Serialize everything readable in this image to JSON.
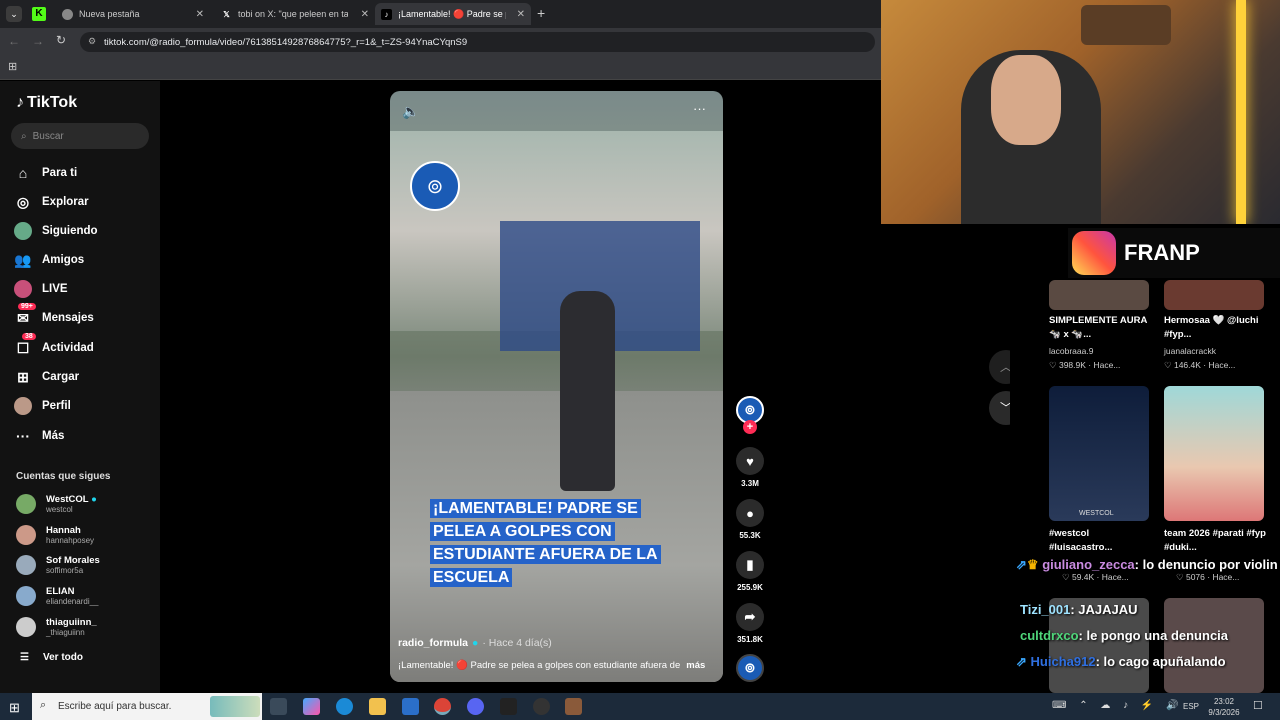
{
  "browser": {
    "tabs": [
      {
        "title": "Nueva pestaña"
      },
      {
        "title": "tobi on X: \"que peleen en tang"
      },
      {
        "title": "¡Lamentable! 🔴 Padre se pele"
      }
    ],
    "url": "tiktok.com/@radio_formula/video/7613851492876864775?_r=1&_t=ZS-94YnaCYqnS9"
  },
  "tiktok": {
    "logo": "TikTok",
    "search_placeholder": "Buscar",
    "nav": [
      {
        "label": "Para ti",
        "icon": "home-icon"
      },
      {
        "label": "Explorar",
        "icon": "compass-icon"
      },
      {
        "label": "Siguiendo",
        "icon": "following-icon"
      },
      {
        "label": "Amigos",
        "icon": "friends-icon"
      },
      {
        "label": "LIVE",
        "icon": "live-icon"
      },
      {
        "label": "Mensajes",
        "icon": "messages-icon",
        "badge": "99+"
      },
      {
        "label": "Actividad",
        "icon": "activity-icon",
        "badge": "38"
      },
      {
        "label": "Cargar",
        "icon": "upload-icon"
      },
      {
        "label": "Perfil",
        "icon": "profile-icon"
      },
      {
        "label": "Más",
        "icon": "more-icon"
      }
    ],
    "following_title": "Cuentas que sigues",
    "following": [
      {
        "name": "WestCOL",
        "handle": "westcol"
      },
      {
        "name": "Hannah",
        "handle": "hannahposey"
      },
      {
        "name": "Sof Morales",
        "handle": "soffimor5a"
      },
      {
        "name": "ELIAN",
        "handle": "eliandenardi__"
      },
      {
        "name": "thiaguiinn_",
        "handle": "_thiaguiinn"
      }
    ],
    "see_all": "Ver todo",
    "video": {
      "overlay_text": "¡LAMENTABLE! PADRE SE PELEA A GOLPES CON ESTUDIANTE AFUERA DE LA ESCUELA",
      "author": "radio_formula",
      "time": "· Hace 4 día(s)",
      "caption": "¡Lamentable! 🔴 Padre se pelea a golpes con estudiante afuera de",
      "more": "más"
    },
    "actions": {
      "likes": "3.3M",
      "comments": "55.3K",
      "saves": "255.9K",
      "shares": "351.8K"
    }
  },
  "stream": {
    "banner": "FRANP",
    "grid": [
      {
        "caption": "SIMPLEMENTE AURA 🐄 x 🐄...",
        "user": "lacobraaa.9",
        "stat": "♡ 398.9K · Hace..."
      },
      {
        "caption": "Hermosaa 🤍 @luchi #fyp...",
        "user": "juanalacrackk",
        "stat": "♡ 146.4K · Hace..."
      },
      {
        "caption": "#westcol #luisacastro...",
        "user": "",
        "stat": "♡ 59.4K · Hace..."
      },
      {
        "caption": "team 2026 #parati #fyp #duki...",
        "user": "",
        "stat": "♡ 5076 · Hace..."
      }
    ],
    "thumb_text": "WESTCOL",
    "chat": [
      {
        "user": "giuliano_zecca",
        "msg": ": lo denuncio por violin"
      },
      {
        "user": "Tizi_001",
        "msg": ": JAJAJAU"
      },
      {
        "user": "cultdrxco",
        "msg": ": le pongo una denuncia"
      },
      {
        "user": "Huicha912",
        "msg": ": lo cago apuñalando"
      }
    ]
  },
  "taskbar": {
    "search_placeholder": "Escribe aquí para buscar.",
    "lang": "ESP",
    "time": "23:02",
    "date": "9/3/2026"
  }
}
